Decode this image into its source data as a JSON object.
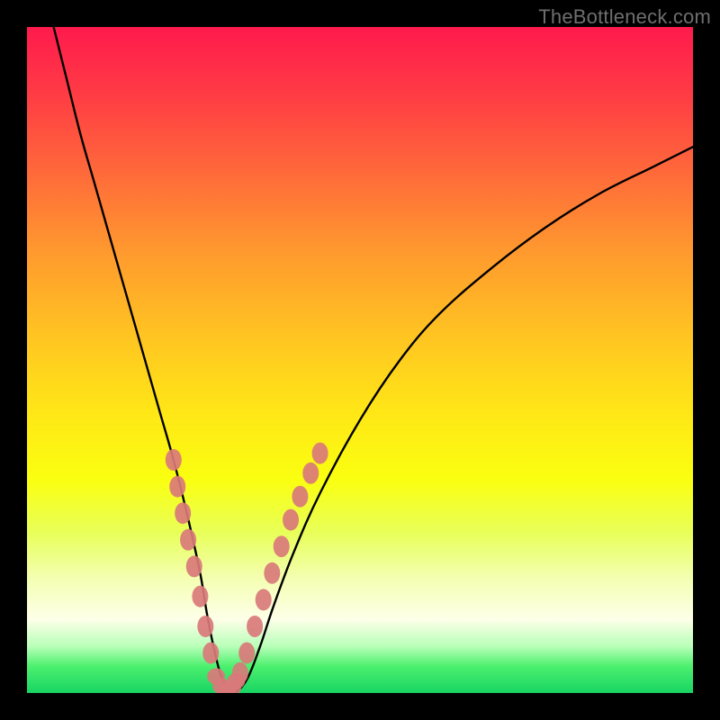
{
  "watermark": "TheBottleneck.com",
  "chart_data": {
    "type": "line",
    "title": "",
    "xlabel": "",
    "ylabel": "",
    "xlim": [
      0,
      100
    ],
    "ylim": [
      0,
      100
    ],
    "curve": {
      "name": "bottleneck-curve",
      "color": "#000000",
      "x": [
        4,
        6,
        8,
        10,
        12,
        14,
        16,
        18,
        20,
        22,
        24,
        26,
        27,
        28,
        29,
        30,
        31,
        33,
        35,
        37,
        40,
        44,
        50,
        56,
        62,
        70,
        78,
        86,
        94,
        100
      ],
      "y": [
        100,
        92,
        84,
        77,
        70,
        63,
        56,
        49,
        42,
        35,
        27,
        18,
        12,
        7,
        3,
        1,
        0,
        2,
        7,
        13,
        21,
        30,
        41,
        50,
        57,
        64,
        70,
        75,
        79,
        82
      ]
    },
    "markers_left": {
      "name": "left-branch-dots",
      "color": "#d97a7a",
      "x": [
        22.0,
        22.6,
        23.4,
        24.2,
        25.1,
        26.0,
        26.8,
        27.6
      ],
      "y": [
        35.0,
        31.0,
        27.0,
        23.0,
        19.0,
        14.5,
        10.0,
        6.0
      ]
    },
    "markers_right": {
      "name": "right-branch-dots",
      "color": "#d97a7a",
      "x": [
        32.0,
        33.0,
        34.2,
        35.5,
        36.8,
        38.2,
        39.6,
        41.0,
        42.6,
        44.0
      ],
      "y": [
        3.0,
        6.0,
        10.0,
        14.0,
        18.0,
        22.0,
        26.0,
        29.5,
        33.0,
        36.0
      ]
    },
    "markers_bottom": {
      "name": "valley-dots",
      "color": "#d97a7a",
      "x": [
        28.4,
        29.2,
        30.0,
        30.8,
        31.4
      ],
      "y": [
        2.5,
        1.0,
        0.5,
        0.8,
        1.8
      ]
    }
  }
}
